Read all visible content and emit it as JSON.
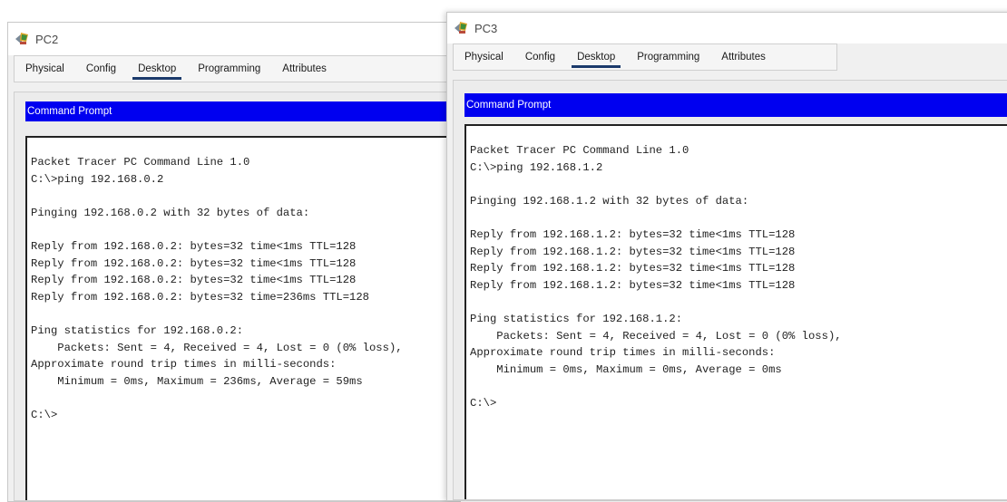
{
  "tab_labels": [
    "Physical",
    "Config",
    "Desktop",
    "Programming",
    "Attributes"
  ],
  "active_tab": "Desktop",
  "pc2": {
    "title": "PC2",
    "tabs": {
      "physical": "Physical",
      "config": "Config",
      "desktop": "Desktop",
      "programming": "Programming",
      "attributes": "Attributes"
    },
    "panel_title": "Command Prompt",
    "terminal_output": "Packet Tracer PC Command Line 1.0\nC:\\>ping 192.168.0.2\n\nPinging 192.168.0.2 with 32 bytes of data:\n\nReply from 192.168.0.2: bytes=32 time<1ms TTL=128\nReply from 192.168.0.2: bytes=32 time<1ms TTL=128\nReply from 192.168.0.2: bytes=32 time<1ms TTL=128\nReply from 192.168.0.2: bytes=32 time=236ms TTL=128\n\nPing statistics for 192.168.0.2:\n    Packets: Sent = 4, Received = 4, Lost = 0 (0% loss),\nApproximate round trip times in milli-seconds:\n    Minimum = 0ms, Maximum = 236ms, Average = 59ms\n\nC:\\>"
  },
  "pc3": {
    "title": "PC3",
    "tabs": {
      "physical": "Physical",
      "config": "Config",
      "desktop": "Desktop",
      "programming": "Programming",
      "attributes": "Attributes"
    },
    "panel_title": "Command Prompt",
    "terminal_output": "Packet Tracer PC Command Line 1.0\nC:\\>ping 192.168.1.2\n\nPinging 192.168.1.2 with 32 bytes of data:\n\nReply from 192.168.1.2: bytes=32 time<1ms TTL=128\nReply from 192.168.1.2: bytes=32 time<1ms TTL=128\nReply from 192.168.1.2: bytes=32 time<1ms TTL=128\nReply from 192.168.1.2: bytes=32 time<1ms TTL=128\n\nPing statistics for 192.168.1.2:\n    Packets: Sent = 4, Received = 4, Lost = 0 (0% loss),\nApproximate round trip times in milli-seconds:\n    Minimum = 0ms, Maximum = 0ms, Average = 0ms\n\nC:\\>"
  },
  "colors": {
    "command_prompt_header": "#0000f0",
    "active_tab_underline": "#1b3a6b",
    "window_background": "#f0f0f0",
    "terminal_background": "#ffffff"
  },
  "icons": {
    "window_icon": "packet-tracer-pc-icon"
  }
}
